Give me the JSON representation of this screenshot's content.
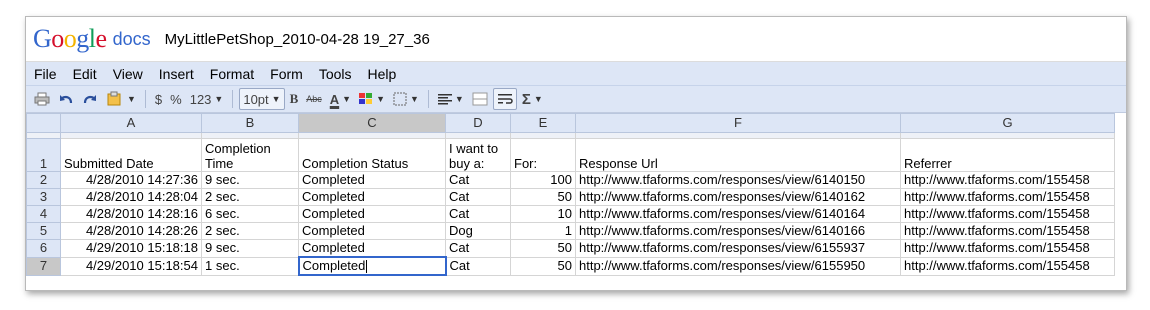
{
  "app": {
    "logo_letters": [
      {
        "ch": "G",
        "color": "#3366cc"
      },
      {
        "ch": "o",
        "color": "#d5102c"
      },
      {
        "ch": "o",
        "color": "#f4b400"
      },
      {
        "ch": "g",
        "color": "#3366cc"
      },
      {
        "ch": "l",
        "color": "#0f9d58"
      },
      {
        "ch": "e",
        "color": "#d5102c"
      }
    ],
    "product": "docs",
    "document_title": "MyLittlePetShop_2010-04-28 19_27_36"
  },
  "menu": [
    "File",
    "Edit",
    "View",
    "Insert",
    "Format",
    "Form",
    "Tools",
    "Help"
  ],
  "toolbar": {
    "currency": "$",
    "percent": "%",
    "number_format": "123",
    "font_size": "10pt",
    "bold": "B",
    "strike": "Abc",
    "text_color": "A",
    "sum": "Σ"
  },
  "columns": [
    "A",
    "B",
    "C",
    "D",
    "E",
    "F",
    "G"
  ],
  "selected_column": "C",
  "header_row": {
    "row_number": "1",
    "cells": [
      "Submitted Date",
      "Completion Time",
      "Completion Status",
      "I want to buy a:",
      "For:",
      "Response Url",
      "Referrer"
    ]
  },
  "rows": [
    {
      "n": "2",
      "cells": [
        "4/28/2010 14:27:36",
        "9 sec.",
        "Completed",
        "Cat",
        "100",
        "http://www.tfaforms.com/responses/view/6140150",
        "http://www.tfaforms.com/155458"
      ]
    },
    {
      "n": "3",
      "cells": [
        "4/28/2010 14:28:04",
        "2 sec.",
        "Completed",
        "Cat",
        "50",
        "http://www.tfaforms.com/responses/view/6140162",
        "http://www.tfaforms.com/155458"
      ]
    },
    {
      "n": "4",
      "cells": [
        "4/28/2010 14:28:16",
        "6 sec.",
        "Completed",
        "Cat",
        "10",
        "http://www.tfaforms.com/responses/view/6140164",
        "http://www.tfaforms.com/155458"
      ]
    },
    {
      "n": "5",
      "cells": [
        "4/28/2010 14:28:26",
        "2 sec.",
        "Completed",
        "Dog",
        "1",
        "http://www.tfaforms.com/responses/view/6140166",
        "http://www.tfaforms.com/155458"
      ]
    },
    {
      "n": "6",
      "cells": [
        "4/29/2010 15:18:18",
        "9 sec.",
        "Completed",
        "Cat",
        "50",
        "http://www.tfaforms.com/responses/view/6155937",
        "http://www.tfaforms.com/155458"
      ]
    },
    {
      "n": "7",
      "cells": [
        "4/29/2010 15:18:54",
        "1 sec.",
        "Completed",
        "Cat",
        "50",
        "http://www.tfaforms.com/responses/view/6155950",
        "http://www.tfaforms.com/155458"
      ]
    }
  ],
  "active_cell": {
    "row": "7",
    "column": "C"
  }
}
